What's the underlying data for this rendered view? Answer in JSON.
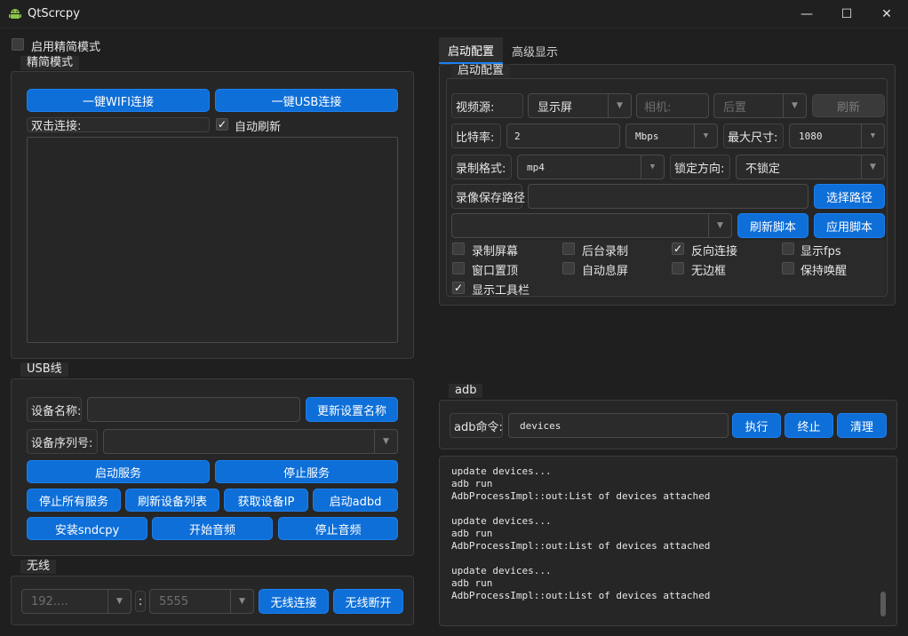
{
  "window": {
    "title": "QtScrcpy",
    "minimize": "—",
    "maximize": "☐",
    "close": "✕"
  },
  "simple_mode": {
    "toggle_label": "启用精简模式",
    "checked": false
  },
  "simple_group": {
    "title": "精简模式",
    "wifi_button": "一键WIFI连接",
    "usb_button": "一键USB连接",
    "double_click_label": "双击连接:",
    "auto_refresh_label": "自动刷新",
    "auto_refresh_checked": true
  },
  "usb_group": {
    "title": "USB线",
    "device_name_label": "设备名称:",
    "device_name_value": "",
    "update_name_button": "更新设置名称",
    "serial_label": "设备序列号:",
    "serial_value": "",
    "start_service": "启动服务",
    "stop_service": "停止服务",
    "stop_all": "停止所有服务",
    "refresh_devices": "刷新设备列表",
    "get_ip": "获取设备IP",
    "start_adbd": "启动adbd",
    "install_sndcpy": "安装sndcpy",
    "start_audio": "开始音频",
    "stop_audio": "停止音频"
  },
  "wireless_group": {
    "title": "无线",
    "ip_value": "192.…",
    "colon": ":",
    "port_value": "5555",
    "connect_button": "无线连接",
    "disconnect_button": "无线断开"
  },
  "tabs": [
    {
      "label": "启动配置",
      "active": true
    },
    {
      "label": "高级显示",
      "active": false
    }
  ],
  "start_config": {
    "title": "启动配置",
    "video_source_label": "视频源:",
    "video_source_value": "显示屏",
    "camera_label": "相机:",
    "camera_pos_value": "后置",
    "refresh_button": "刷新",
    "bitrate_label": "比特率:",
    "bitrate_value": "2",
    "bitrate_unit": "Mbps",
    "max_size_label": "最大尺寸:",
    "max_size_value": "1080",
    "record_format_label": "录制格式:",
    "record_format_value": "mp4",
    "lock_orientation_label": "锁定方向:",
    "lock_orientation_value": "不锁定",
    "record_path_label": "录像保存路径",
    "record_path_value": "",
    "choose_path_button": "选择路径",
    "script_value": "",
    "refresh_script_button": "刷新脚本",
    "apply_script_button": "应用脚本",
    "checkboxes": [
      {
        "label": "录制屏幕",
        "checked": false
      },
      {
        "label": "后台录制",
        "checked": false
      },
      {
        "label": "反向连接",
        "checked": true
      },
      {
        "label": "显示fps",
        "checked": false
      },
      {
        "label": "窗口置顶",
        "checked": false
      },
      {
        "label": "自动息屏",
        "checked": false
      },
      {
        "label": "无边框",
        "checked": false
      },
      {
        "label": "保持唤醒",
        "checked": false
      },
      {
        "label": "显示工具栏",
        "checked": true
      }
    ]
  },
  "adb": {
    "title": "adb",
    "command_label": "adb命令:",
    "command_value": "devices",
    "execute_button": "执行",
    "terminate_button": "终止",
    "clear_button": "清理",
    "log_lines": [
      "update devices...",
      "adb run",
      "AdbProcessImpl::out:List of devices attached",
      "",
      "update devices...",
      "adb run",
      "AdbProcessImpl::out:List of devices attached",
      "",
      "update devices...",
      "adb run",
      "AdbProcessImpl::out:List of devices attached"
    ]
  },
  "colors": {
    "accent": "#0e6fd8",
    "background": "#1f1f1f"
  }
}
